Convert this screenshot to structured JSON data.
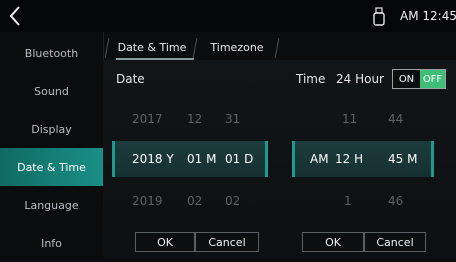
{
  "status_bar": {
    "time": "AM 12:45"
  },
  "sidebar": {
    "items": [
      {
        "label": "Bluetooth"
      },
      {
        "label": "Sound"
      },
      {
        "label": "Display"
      },
      {
        "label": "Date & Time"
      },
      {
        "label": "Language"
      },
      {
        "label": "Info"
      }
    ],
    "active_index": 3
  },
  "tabs": [
    {
      "label": "Date & Time"
    },
    {
      "label": "Timezone"
    }
  ],
  "date": {
    "label": "Date",
    "prev": {
      "year": "2017",
      "month": "12",
      "day": "31"
    },
    "current": {
      "year": "2018 Y",
      "month": "01 M",
      "day": "01 D"
    },
    "next": {
      "year": "2019",
      "month": "02",
      "day": "02"
    },
    "ok_label": "OK",
    "cancel_label": "Cancel"
  },
  "time": {
    "label": "Time",
    "format_label": "24 Hour",
    "toggle_on": "ON",
    "toggle_off": "OFF",
    "prev": {
      "hour": "11",
      "minute": "44"
    },
    "current": {
      "ampm": "AM",
      "hour": "12 H",
      "minute": "45 M"
    },
    "next": {
      "hour": "1",
      "minute": "46"
    },
    "ok_label": "OK",
    "cancel_label": "Cancel"
  },
  "colors": {
    "accent": "#1f9a8f",
    "toggle_active": "#3dbd77",
    "background": "#0b0d0f"
  }
}
